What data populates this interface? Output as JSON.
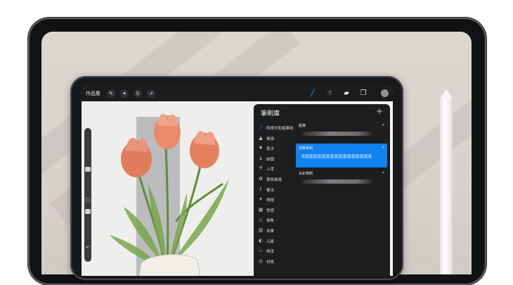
{
  "toolbar": {
    "gallery_label": "作品集",
    "left_icons": [
      "wrench-icon",
      "magic-wand-icon",
      "selection-s-icon",
      "transform-arrow-icon"
    ],
    "right_icons": [
      "brush-icon",
      "smudge-icon",
      "eraser-icon",
      "layers-icon"
    ]
  },
  "panel": {
    "title": "筆刷庫",
    "add_symbol": "+",
    "categories": [
      {
        "label": "阿偉兒和諧筆刷",
        "icon": "brush-stroke-icon"
      },
      {
        "label": "素描",
        "icon": "pencil-tip-icon"
      },
      {
        "label": "墨水",
        "icon": "ink-drop-icon"
      },
      {
        "label": "繪圖",
        "icon": "swirl-icon"
      },
      {
        "label": "上漆",
        "icon": "paint-brush-icon"
      },
      {
        "label": "藝術風格",
        "icon": "palette-icon"
      },
      {
        "label": "書法",
        "icon": "calligraphy-icon"
      },
      {
        "label": "噴槍",
        "icon": "airbrush-icon"
      },
      {
        "label": "質感",
        "icon": "texture-icon"
      },
      {
        "label": "抽象",
        "icon": "triangle-icon"
      },
      {
        "label": "炭筆",
        "icon": "charcoal-icon"
      },
      {
        "label": "元素",
        "icon": "yin-yang-icon"
      },
      {
        "label": "噴漆",
        "icon": "spray-icon"
      },
      {
        "label": "材質",
        "icon": "material-icon"
      }
    ],
    "brushes": [
      {
        "name": "鉛筆",
        "selected": false
      },
      {
        "name": "噴霧筆刷",
        "selected": true
      },
      {
        "name": "水彩筆刷",
        "selected": false
      }
    ]
  },
  "colors": {
    "accent": "#1282f0",
    "panel_bg": "#1d1e20",
    "toolbar_bg": "#1b1c1e"
  }
}
